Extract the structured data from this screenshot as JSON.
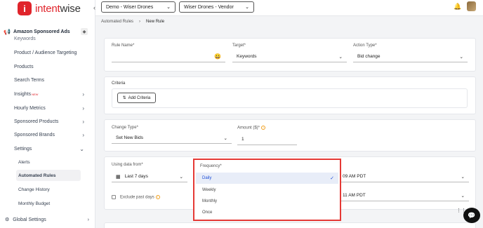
{
  "app": {
    "logo_letter": "i",
    "logo_text_pre": "intent",
    "logo_text_post": "wise"
  },
  "topbar": {
    "account": "Demo - Wiser Drones",
    "profile": "Wiser Drones - Vendor"
  },
  "sidebar": {
    "header": "Amazon Sponsored Ads",
    "items": [
      {
        "label": "Keywords"
      },
      {
        "label": "Product / Audience Targeting"
      },
      {
        "label": "Products"
      },
      {
        "label": "Search Terms"
      },
      {
        "label": "Insights",
        "badge": "NEW"
      },
      {
        "label": "Hourly Metrics"
      },
      {
        "label": "Sponsored Products"
      },
      {
        "label": "Sponsored Brands"
      },
      {
        "label": "Settings"
      }
    ],
    "sub_items": [
      {
        "label": "Alerts"
      },
      {
        "label": "Automated Rules"
      },
      {
        "label": "Change History"
      },
      {
        "label": "Monthly Budget"
      }
    ],
    "footer": "Global Settings"
  },
  "breadcrumb": {
    "parent": "Automated Rules",
    "current": "New Rule"
  },
  "form": {
    "rule_name_label": "Rule Name*",
    "rule_name_value": "",
    "target_label": "Target*",
    "target_value": "Keywords",
    "action_label": "Action Type*",
    "action_value": "Bid change",
    "criteria_label": "Criteria",
    "add_criteria": "Add Criteria",
    "change_type_label": "Change Type*",
    "change_type_value": "Set New Bids",
    "amount_label": "Amount ($)*",
    "amount_value": "1",
    "using_data_label": "Using data from*",
    "using_data_value": "Last 7 days",
    "exclude_label": "Exclude past days",
    "time1": "09 AM PDT",
    "time2": "11 AM PDT"
  },
  "frequency": {
    "label": "Frequency*",
    "options": [
      "Daily",
      "Weekly",
      "Monthly",
      "Once"
    ],
    "selected": "Daily"
  },
  "colors": {
    "brand": "#e0242b",
    "highlight_border": "#e53935",
    "selected": "#1d4ed8"
  }
}
